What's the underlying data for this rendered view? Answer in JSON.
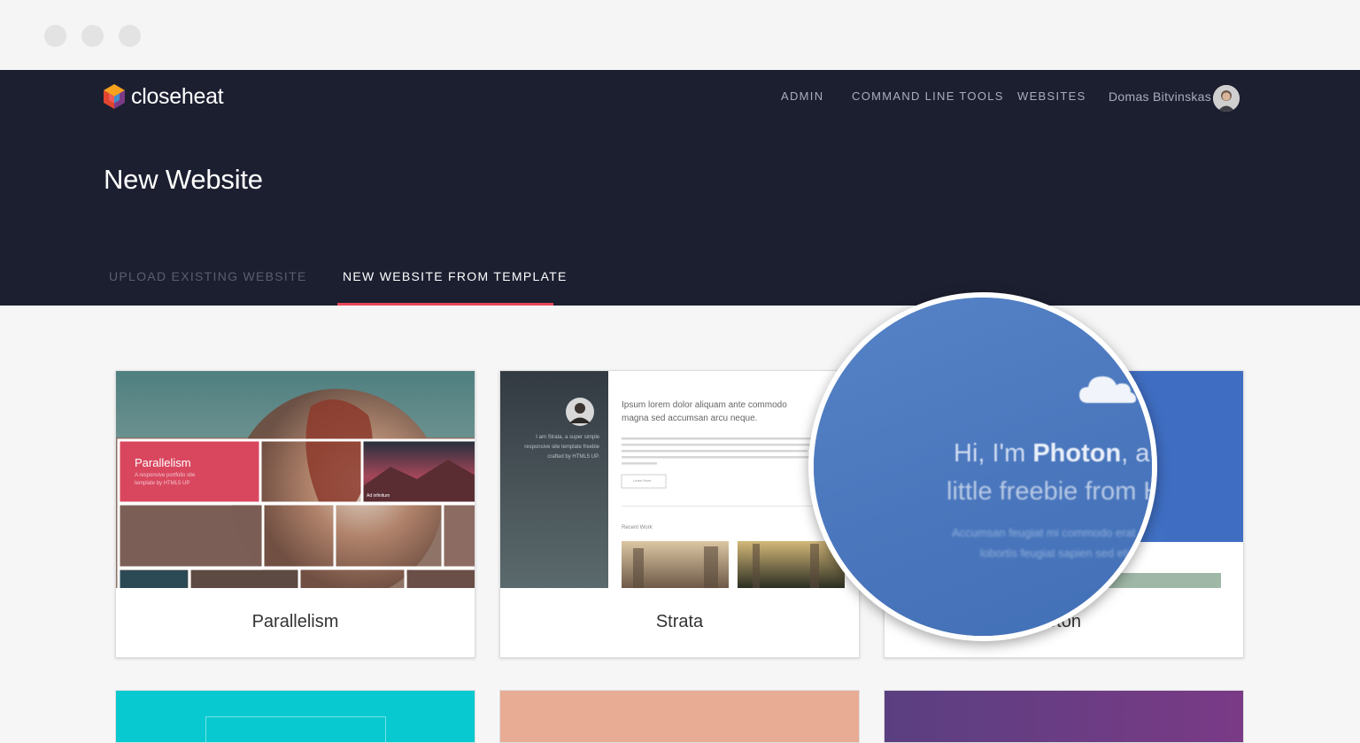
{
  "header": {
    "app_name": "closeheat",
    "nav": {
      "admin": "ADMIN",
      "cli": "COMMAND LINE TOOLS",
      "websites": "WEBSITES"
    },
    "user_name": "Domas Bitvinskas"
  },
  "page_title": "New Website",
  "tabs": [
    {
      "label": "UPLOAD EXISTING WEBSITE",
      "active": false
    },
    {
      "label": "NEW WEBSITE FROM TEMPLATE",
      "active": true
    }
  ],
  "templates": [
    {
      "name": "Parallelism",
      "preview": {
        "title": "Parallelism",
        "subtitle": "A responsive portfolio site template by HTML5 UP",
        "caption": "Ad infinitum"
      }
    },
    {
      "name": "Strata",
      "preview": {
        "sidebar_text": "I am Strata, a super simple responsive site template freebie crafted by HTML5 UP.",
        "heading": "Ipsum lorem dolor aliquam ante commodo magna sed accumsan arcu neque.",
        "button": "Learn More",
        "section": "Recent Work"
      }
    },
    {
      "name": "Photon",
      "visible_name": "oton"
    }
  ],
  "magnifier": {
    "line1_prefix": "Hi, I'm ",
    "line1_bold": "Photon",
    "line1_suffix": ", a",
    "line2": "little freebie from H",
    "line3": "Accumsan feugiat mi commodo erat",
    "line4": "lobortis feugiat sapien sed etiam"
  },
  "colors": {
    "header_bg": "#1c1f30",
    "tab_accent": "#e9475a",
    "photon_blue": "#4c79bf",
    "parallelism_pink": "#d9475f"
  }
}
